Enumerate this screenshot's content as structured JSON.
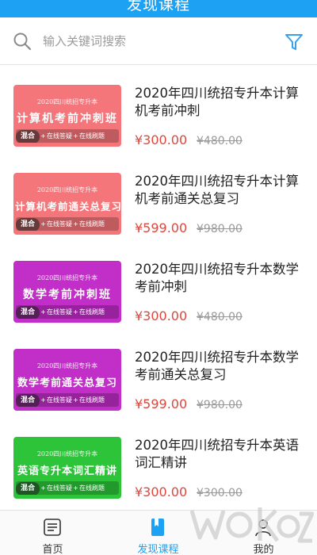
{
  "header": {
    "title": "发现课程"
  },
  "search": {
    "placeholder": "输入关键词搜索",
    "search_icon": "search-icon",
    "filter_icon": "filter-icon"
  },
  "courses": [
    {
      "title": "2020年四川统招专升本计算机考前冲刺",
      "price": "¥300.00",
      "old_price": "¥480.00",
      "thumb": {
        "top": "2020四川统招专升本",
        "main": "计算机考前冲刺班",
        "tag1": "混合",
        "tag2": "在线答疑",
        "tag3": "在线刷题",
        "color": "#f4757a"
      }
    },
    {
      "title": "2020年四川统招专升本计算机考前通关总复习",
      "price": "¥599.00",
      "old_price": "¥980.00",
      "thumb": {
        "top": "2020四川统招专升本",
        "main": "计算机考前通关总复习",
        "tag1": "混合",
        "tag2": "在线答疑",
        "tag3": "在线刷题",
        "color": "#f4757a"
      }
    },
    {
      "title": "2020年四川统招专升本数学考前冲刺",
      "price": "¥300.00",
      "old_price": "¥480.00",
      "thumb": {
        "top": "2020四川统招专升本",
        "main": "数学考前冲刺班",
        "tag1": "混合",
        "tag2": "在线答疑",
        "tag3": "在线刷题",
        "color": "#c12ec8"
      }
    },
    {
      "title": "2020年四川统招专升本数学考前通关总复习",
      "price": "¥599.00",
      "old_price": "¥980.00",
      "thumb": {
        "top": "2020四川统招专升本",
        "main": "数学考前通关总复习",
        "tag1": "混合",
        "tag2": "在线答疑",
        "tag3": "在线刷题",
        "color": "#c12ec8"
      }
    },
    {
      "title": "2020年四川统招专升本英语词汇精讲",
      "price": "¥300.00",
      "old_price": "¥300.00",
      "thumb": {
        "top": "2020四川统招专升本",
        "main": "英语专升本词汇精讲",
        "tag1": "混合",
        "tag2": "在线答疑",
        "tag3": "在线刷题",
        "color": "#2ec43a"
      }
    }
  ],
  "tabs": [
    {
      "label": "首页",
      "icon": "home-list-icon"
    },
    {
      "label": "发现课程",
      "icon": "bookmark-book-icon",
      "active": true
    },
    {
      "label": "我的",
      "icon": "user-icon"
    }
  ],
  "colors": {
    "accent": "#1da1f2",
    "price": "#e0463c"
  }
}
